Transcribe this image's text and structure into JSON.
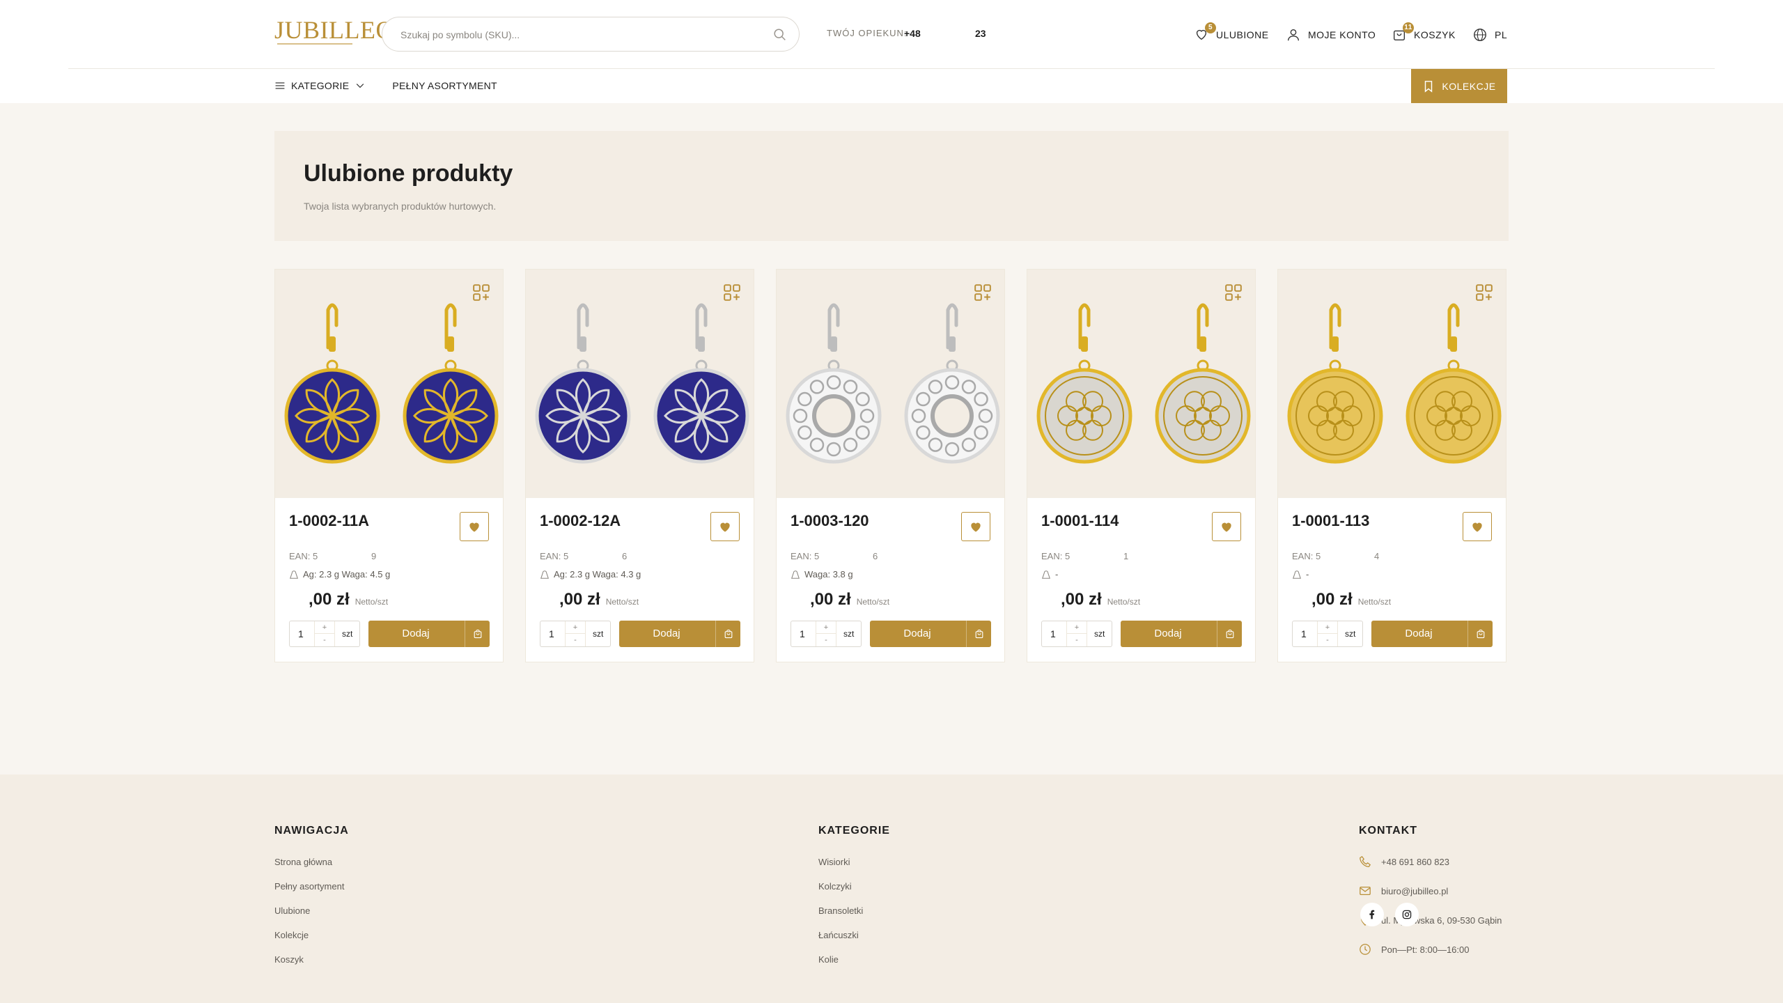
{
  "header": {
    "logo_text": "JUBILLEO",
    "search_placeholder": "Szukaj po symbolu (SKU)...",
    "opiekun_label": "TWÓJ OPIEKUN:",
    "opiekun_phone_a": "+48",
    "opiekun_phone_b": "23",
    "favorites_label": "ULUBIONE",
    "favorites_count": "5",
    "account_label": "MOJE KONTO",
    "cart_label": "KOSZYK",
    "cart_count": "11",
    "language_label": "PL"
  },
  "nav": {
    "categories_label": "KATEGORIE",
    "full_assortment_label": "PEŁNY ASORTYMENT",
    "collections_label": "KOLEKCJE"
  },
  "hero": {
    "title": "Ulubione produkty",
    "subtitle": "Twoja lista wybranych produktów hurtowych."
  },
  "products": [
    {
      "sku": "1-0002-11A",
      "ean_a": "EAN: 5",
      "ean_b": "9",
      "meta": "Ag: 2.3 g Waga: 4.5 g",
      "price": ",00 zł",
      "price_unit": "Netto/szt",
      "qty": "1",
      "qty_unit": "szt",
      "add_label": "Dodaj",
      "metal": "gold",
      "enamel": "#2d2a8a",
      "pattern": "leaf"
    },
    {
      "sku": "1-0002-12A",
      "ean_a": "EAN: 5",
      "ean_b": "6",
      "meta": "Ag: 2.3 g Waga: 4.3 g",
      "price": ",00 zł",
      "price_unit": "Netto/szt",
      "qty": "1",
      "qty_unit": "szt",
      "add_label": "Dodaj",
      "metal": "silver",
      "enamel": "#2d2a8a",
      "pattern": "leaf"
    },
    {
      "sku": "1-0003-120",
      "ean_a": "EAN: 5",
      "ean_b": "6",
      "meta": "Waga: 3.8 g",
      "price": ",00 zł",
      "price_unit": "Netto/szt",
      "qty": "1",
      "qty_unit": "szt",
      "add_label": "Dodaj",
      "metal": "silver",
      "enamel": "none",
      "pattern": "ring"
    },
    {
      "sku": "1-0001-114",
      "ean_a": "EAN: 5",
      "ean_b": "1",
      "meta": "-",
      "price": ",00 zł",
      "price_unit": "Netto/szt",
      "qty": "1",
      "qty_unit": "szt",
      "add_label": "Dodaj",
      "metal": "gold",
      "enamel": "#d9d6cf",
      "pattern": "flower"
    },
    {
      "sku": "1-0001-113",
      "ean_a": "EAN: 5",
      "ean_b": "4",
      "meta": "-",
      "price": ",00 zł",
      "price_unit": "Netto/szt",
      "qty": "1",
      "qty_unit": "szt",
      "add_label": "Dodaj",
      "metal": "gold",
      "enamel": "#e7c45a",
      "pattern": "flower"
    }
  ],
  "footer": {
    "nav_title": "NAWIGACJA",
    "nav_links": [
      "Strona główna",
      "Pełny asortyment",
      "Ulubione",
      "Kolekcje",
      "Koszyk"
    ],
    "cat_title": "KATEGORIE",
    "cat_links": [
      "Wisiorki",
      "Kolczyki",
      "Bransoletki",
      "Łańcuszki",
      "Kolie"
    ],
    "contact_title": "KONTAKT",
    "contact": {
      "phone": "+48 691 860 823",
      "email": "biuro@jubilleo.pl",
      "address": "ul. Myśliwska 6, 09-530 Gąbin",
      "hours": "Pon—Pt: 8:00—16:00"
    }
  },
  "colors": {
    "accent": "#b98f37",
    "beige": "#f3ede4",
    "background": "#f8f5f0"
  }
}
